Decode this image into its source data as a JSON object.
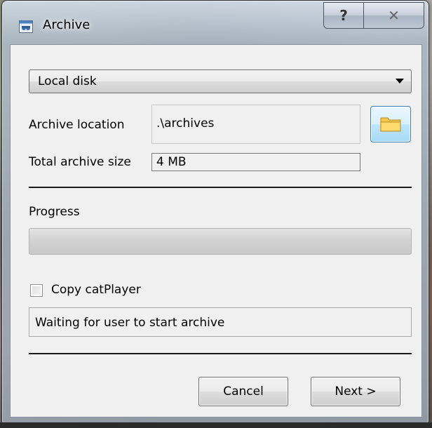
{
  "window": {
    "title": "Archive",
    "help_label": "?",
    "close_label": "✕"
  },
  "source": {
    "selected": "Local disk"
  },
  "archive_location": {
    "label": "Archive location",
    "value": ".\\archives"
  },
  "total_size": {
    "label": "Total archive size",
    "value": "4 MB"
  },
  "progress": {
    "label": "Progress",
    "percent": 0
  },
  "copy_catplayer": {
    "label": "Copy catPlayer",
    "checked": false
  },
  "status": {
    "text": "Waiting for user to start archive"
  },
  "buttons": {
    "cancel": "Cancel",
    "next": "Next >"
  },
  "icons": {
    "app": "archive-app-icon",
    "browse": "folder-icon",
    "dropdown": "chevron-down-icon"
  }
}
